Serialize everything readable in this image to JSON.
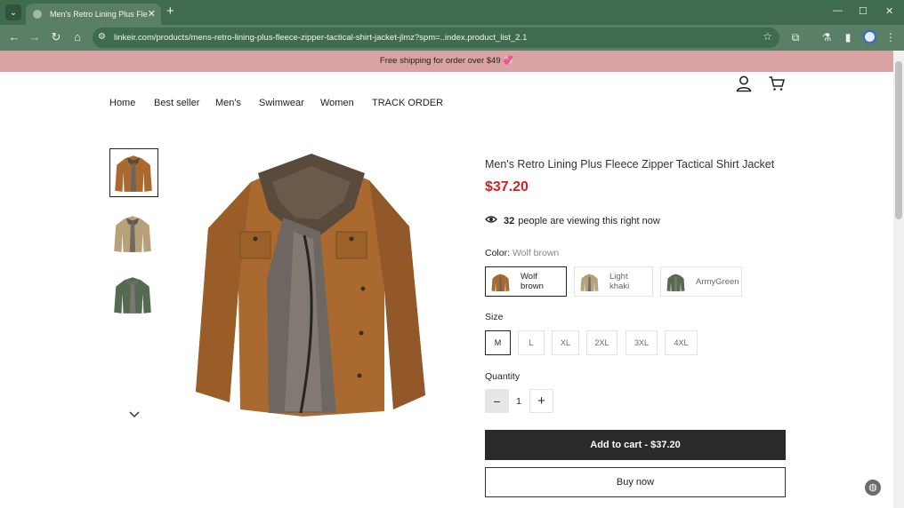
{
  "browser": {
    "tab_title": "Men's Retro Lining Plus Fleece Zipper Tactical Shirt Jacket",
    "url": "linkeir.com/products/mens-retro-lining-plus-fleece-zipper-tactical-shirt-jacket-jlmz?spm=..index.product_list_2.1"
  },
  "promo": {
    "text": "Free shipping for order over $49 💞"
  },
  "nav": {
    "items": [
      "Home",
      "Best seller",
      "Men's",
      "Swimwear",
      "Women",
      "TRACK ORDER"
    ]
  },
  "product": {
    "title": "Men's Retro Lining Plus Fleece Zipper Tactical Shirt Jacket",
    "price": "$37.20",
    "viewing_count": "32",
    "viewing_text": "people are viewing this right now",
    "color_label": "Color:",
    "color_selected": "Wolf brown",
    "colors": [
      "Wolf brown",
      "Light khaki",
      "ArmyGreen"
    ],
    "size_label": "Size",
    "sizes": [
      "M",
      "L",
      "XL",
      "2XL",
      "3XL",
      "4XL"
    ],
    "selected_size": "M",
    "quantity_label": "Quantity",
    "quantity": "1",
    "minus": "−",
    "plus": "+",
    "add_to_cart": "Add to cart - $37.20",
    "buy_now": "Buy now"
  },
  "colors": {
    "chrome_dark": "#3f6b4f",
    "chrome_light": "#5a7f66",
    "promo_bg": "#d9a3a3",
    "price_red": "#d41f1f",
    "button_dark": "#2a2a2a",
    "jacket_brown": "#a9692f",
    "jacket_khaki": "#b7a178",
    "jacket_green": "#556b4f"
  }
}
